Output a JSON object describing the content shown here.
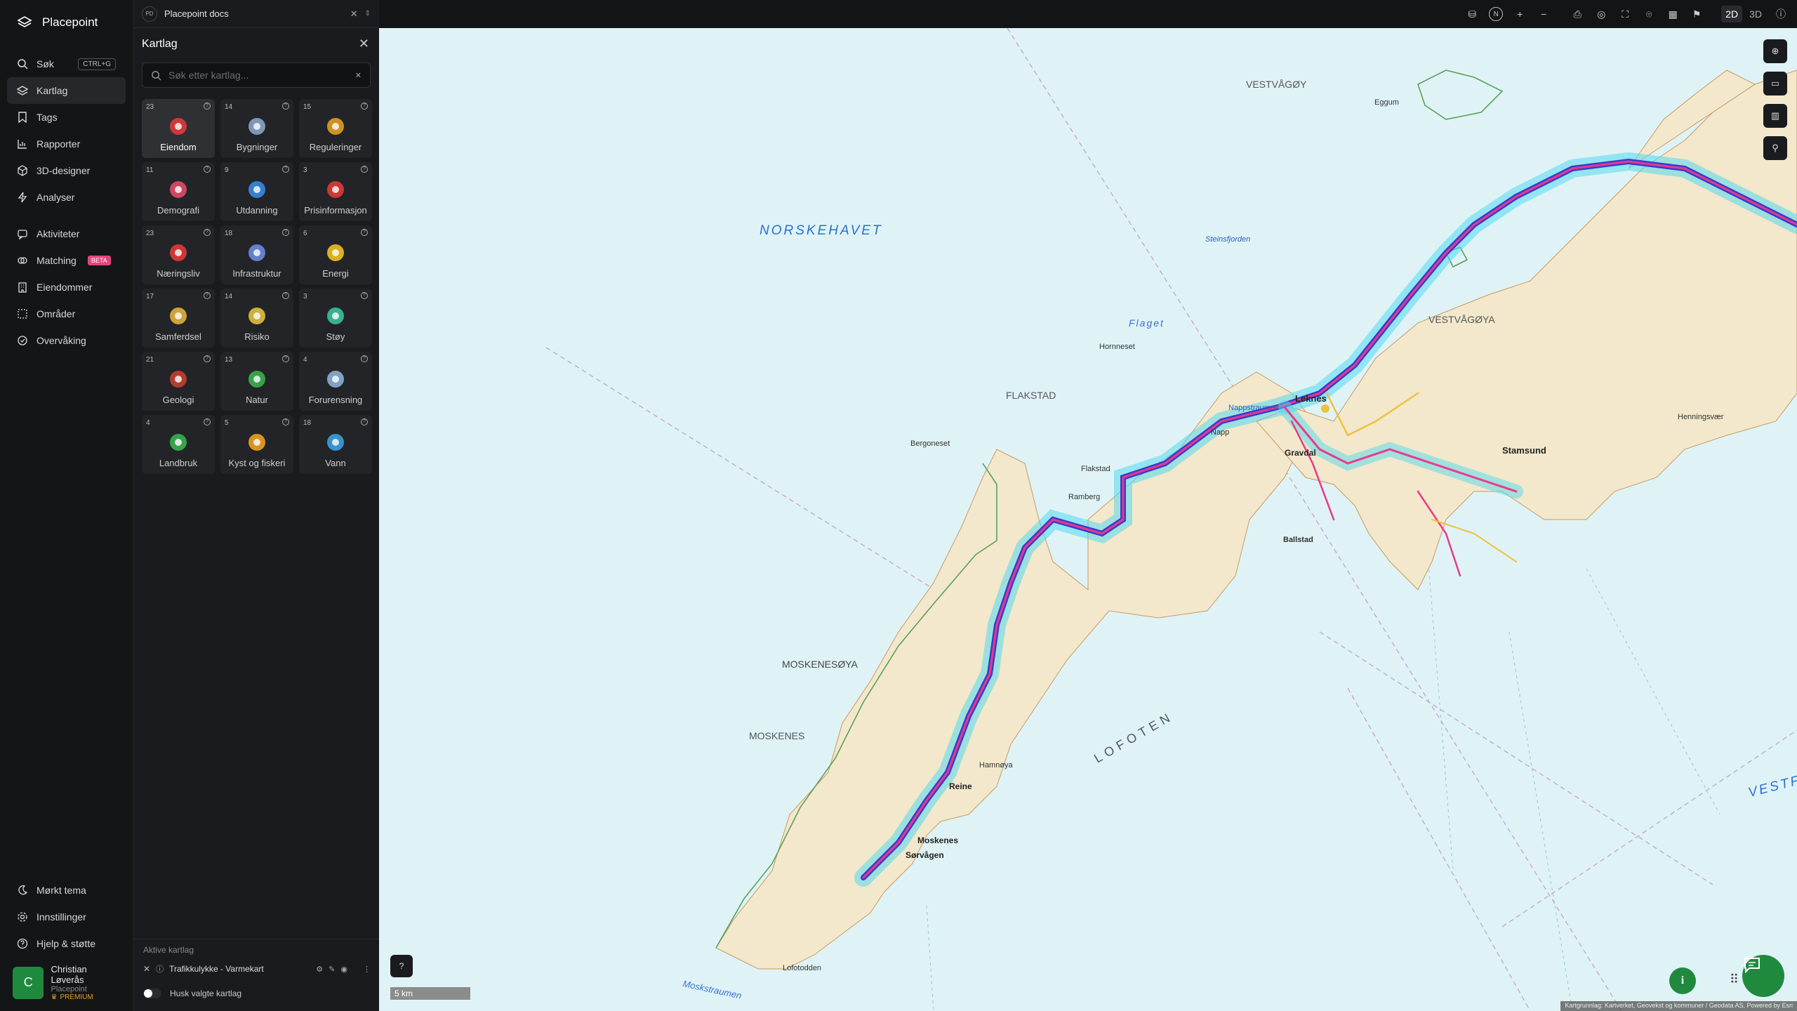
{
  "app": {
    "name": "Placepoint"
  },
  "nav": {
    "items": [
      {
        "label": "Søk",
        "shortcut": "CTRL+G",
        "icon": "search-icon"
      },
      {
        "label": "Kartlag",
        "icon": "layers-icon"
      },
      {
        "label": "Tags",
        "icon": "bookmark-icon"
      },
      {
        "label": "Rapporter",
        "icon": "chart-icon"
      },
      {
        "label": "3D-designer",
        "icon": "cube-icon"
      },
      {
        "label": "Analyser",
        "icon": "bolt-icon"
      }
    ],
    "items2": [
      {
        "label": "Aktiviteter",
        "icon": "activity-icon"
      },
      {
        "label": "Matching",
        "badge": "BETA",
        "icon": "match-icon"
      },
      {
        "label": "Eiendommer",
        "icon": "building-icon"
      },
      {
        "label": "Områder",
        "icon": "area-icon"
      },
      {
        "label": "Overvåking",
        "icon": "watch-icon"
      }
    ],
    "bottom": [
      {
        "label": "Mørkt tema",
        "icon": "moon-icon"
      },
      {
        "label": "Innstillinger",
        "icon": "gear-icon"
      },
      {
        "label": "Hjelp & støtte",
        "icon": "help-icon"
      }
    ],
    "user": {
      "initial": "C",
      "name": "Christian Løverås",
      "org": "Placepoint",
      "plan": "PREMIUM"
    }
  },
  "tab": {
    "badge": "PD",
    "title": "Placepoint docs"
  },
  "panel": {
    "title": "Kartlag",
    "search_placeholder": "Søk etter kartlag...",
    "tiles": [
      {
        "count": "23",
        "label": "Eiendom",
        "icon": "pin-icon",
        "color": "#e03a3a"
      },
      {
        "count": "14",
        "label": "Bygninger",
        "icon": "buildings-icon",
        "color": "#8aa4c8"
      },
      {
        "count": "15",
        "label": "Reguleringer",
        "icon": "signpost-icon",
        "color": "#e0a020"
      },
      {
        "count": "11",
        "label": "Demografi",
        "icon": "people-icon",
        "color": "#e04a6a"
      },
      {
        "count": "9",
        "label": "Utdanning",
        "icon": "graduation-icon",
        "color": "#3a8ae0"
      },
      {
        "count": "3",
        "label": "Prisinformasjon",
        "icon": "bag-icon",
        "color": "#e03a3a"
      },
      {
        "count": "23",
        "label": "Næringsliv",
        "icon": "shopping-icon",
        "color": "#e03a3a"
      },
      {
        "count": "18",
        "label": "Infrastruktur",
        "icon": "globe-icon",
        "color": "#6a8ae0"
      },
      {
        "count": "6",
        "label": "Energi",
        "icon": "lightning-icon",
        "color": "#f0c020"
      },
      {
        "count": "17",
        "label": "Samferdsel",
        "icon": "train-icon",
        "color": "#e0b040"
      },
      {
        "count": "14",
        "label": "Risiko",
        "icon": "hazard-icon",
        "color": "#e0c040"
      },
      {
        "count": "3",
        "label": "Støy",
        "icon": "gauge-icon",
        "color": "#3ac0a0"
      },
      {
        "count": "21",
        "label": "Geologi",
        "icon": "terrain-icon",
        "color": "#c04030"
      },
      {
        "count": "13",
        "label": "Natur",
        "icon": "leaf-icon",
        "color": "#3ab050"
      },
      {
        "count": "4",
        "label": "Forurensning",
        "icon": "factory-icon",
        "color": "#8ab0d8"
      },
      {
        "count": "4",
        "label": "Landbruk",
        "icon": "sprout-icon",
        "color": "#3ab050"
      },
      {
        "count": "5",
        "label": "Kyst og fiskeri",
        "icon": "fish-icon",
        "color": "#f0a020"
      },
      {
        "count": "18",
        "label": "Vann",
        "icon": "drop-icon",
        "color": "#3aa0e0"
      }
    ],
    "active_title": "Aktive kartlag",
    "active_layer": "Trafikkulykke - Varmekart",
    "remember_label": "Husk valgte kartlag"
  },
  "toolbar": {
    "compass": "N",
    "mode_2d": "2D",
    "mode_3d": "3D"
  },
  "map": {
    "scale": "5 km",
    "attribution": "Kartgrunnlag: Kartverket, Geovekst og kommuner / Geodata AS, Powered by Esri",
    "labels": {
      "sea": "NORSKEHAVET",
      "lofoten": "LOFOTEN",
      "vestvagoy": "VESTVÅGØY",
      "vestvagoy2": "VESTVÅGØYA",
      "flakstad": "FLAKSTAD",
      "moskenesoya": "MOSKENESØYA",
      "moskenes": "MOSKENES",
      "flaget": "Flaget",
      "reine": "Reine",
      "moskenes_village": "Moskenes",
      "sorvagen": "Sørvågen",
      "leknes": "Leknes",
      "gravdal": "Gravdal",
      "stamsund": "Stamsund",
      "ballstad": "Ballstad",
      "napp": "Napp",
      "ramberg": "Ramberg",
      "flakstad_village": "Flakstad",
      "hamnoya": "Hamnøya",
      "lofotodden": "Lofotodden",
      "moskstraumen": "Moskstraumen",
      "henningsvaer": "Henningsvær",
      "eggum": "Eggum",
      "bergoneset": "Bergoneset",
      "hornneset": "Hornneset",
      "napstraumen": "Nappstraumen",
      "steinsfjorden": "Steinsfjorden",
      "vestf": "VESTF"
    }
  }
}
